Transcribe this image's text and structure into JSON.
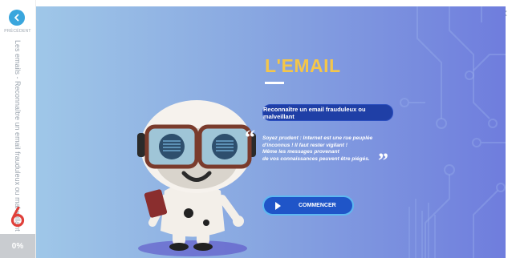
{
  "sidebar": {
    "back_label": "PRÉCÉDENT",
    "vertical_title": "Les emails - Reconnaître un email frauduleux ou malveillant",
    "progress": "0%"
  },
  "hero": {
    "title": "L'EMAIL",
    "subtitle": "Reconnaître un email frauduleux ou malveillant",
    "quote_lines": [
      "Soyez prudent : Internet est une rue peuplée",
      "d'inconnus ! Il faut rester vigilant !",
      "Même les messages provenant",
      "de vos connaissances peuvent être piégés."
    ],
    "start_label": "COMMENCER"
  },
  "icons": {
    "back": "chevron-left-icon",
    "close": "close-icon",
    "play": "play-icon",
    "quote_open": "quote-open-icon",
    "quote_close": "quote-close-icon"
  },
  "colors": {
    "accent_blue": "#3aa6dd",
    "title_yellow": "#f4c64a",
    "pill_blue": "#1f3fa6",
    "button_blue": "#1f55c8",
    "brand_red": "#e0403a"
  }
}
